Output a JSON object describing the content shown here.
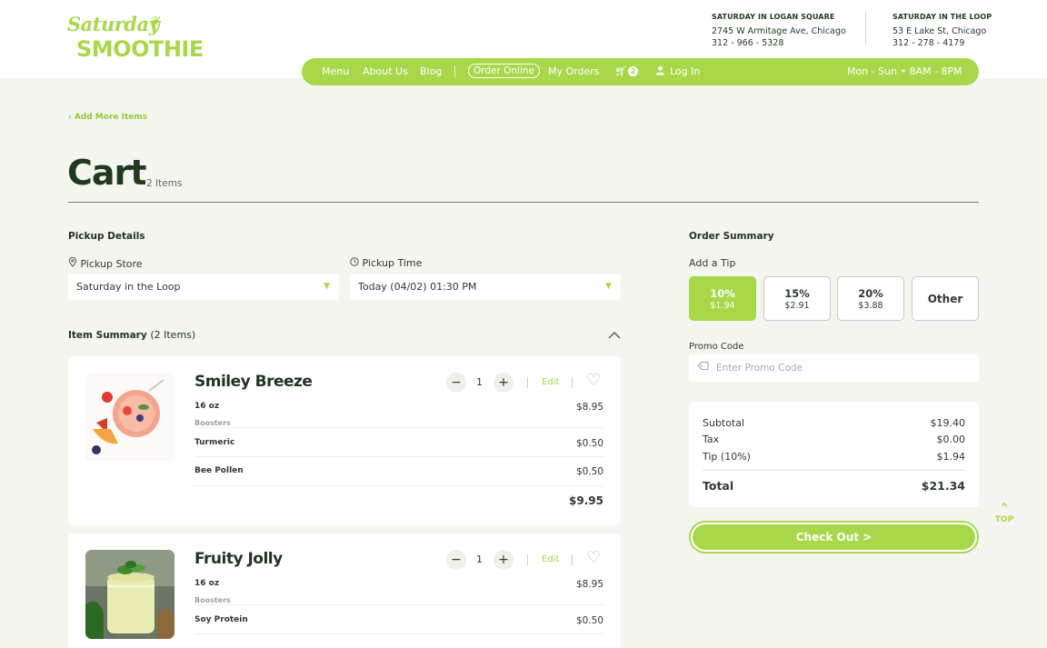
{
  "brand": {
    "line1": "Saturday",
    "line2": "SMOOTHIE"
  },
  "locations": [
    {
      "name": "SATURDAY IN LOGAN SQUARE",
      "address": "2745 W Armitage Ave, Chicago",
      "phone": "312 - 966 - 5328"
    },
    {
      "name": "SATURDAY IN THE LOOP",
      "address": "53 E Lake St, Chicago",
      "phone": "312 - 278 - 4179"
    }
  ],
  "nav": {
    "menu": "Menu",
    "about": "About Us",
    "blog": "Blog",
    "order_online": "Order Online",
    "my_orders": "My Orders",
    "cart_badge": "2",
    "login": "Log In",
    "hours": "Mon - Sun • 8AM - 8PM"
  },
  "back_link": "Add More Items",
  "page_title": "Cart",
  "item_count": "2 Items",
  "pickup": {
    "heading": "Pickup Details",
    "store_label": "Pickup Store",
    "store_value": "Saturday in the Loop",
    "time_label": "Pickup Time",
    "time_value": "Today (04/02) 01:30 PM"
  },
  "item_summary": {
    "heading": "Item Summary",
    "count": "(2 Items)"
  },
  "items": [
    {
      "name": "Smiley Breeze",
      "qty": "1",
      "edit": "Edit",
      "size": "16 oz",
      "size_price": "$8.95",
      "boosters_label": "Boosters",
      "boosters": [
        {
          "name": "Turmeric",
          "price": "$0.50"
        },
        {
          "name": "Bee Pollen",
          "price": "$0.50"
        }
      ],
      "total": "$9.95"
    },
    {
      "name": "Fruity Jolly",
      "qty": "1",
      "edit": "Edit",
      "size": "16 oz",
      "size_price": "$8.95",
      "boosters_label": "Boosters",
      "boosters": [
        {
          "name": "Soy Protein",
          "price": "$0.50"
        }
      ]
    }
  ],
  "order_summary": {
    "heading": "Order Summary",
    "tip_label": "Add a Tip",
    "tips": [
      {
        "pct": "10%",
        "amount": "$1.94",
        "selected": true
      },
      {
        "pct": "15%",
        "amount": "$2.91",
        "selected": false
      },
      {
        "pct": "20%",
        "amount": "$3.88",
        "selected": false
      }
    ],
    "tip_other": "Other",
    "promo_label": "Promo Code",
    "promo_placeholder": "Enter Promo Code",
    "subtotal_label": "Subtotal",
    "subtotal": "$19.40",
    "tax_label": "Tax",
    "tax": "$0.00",
    "tip_line_label": "Tip (10%)",
    "tip_line": "$1.94",
    "total_label": "Total",
    "total": "$21.34",
    "checkout": "Check Out >"
  },
  "to_top": "TOP",
  "colors": {
    "accent": "#a8d84a",
    "dark_green": "#1f3a1f",
    "background": "#f5f5f0"
  }
}
